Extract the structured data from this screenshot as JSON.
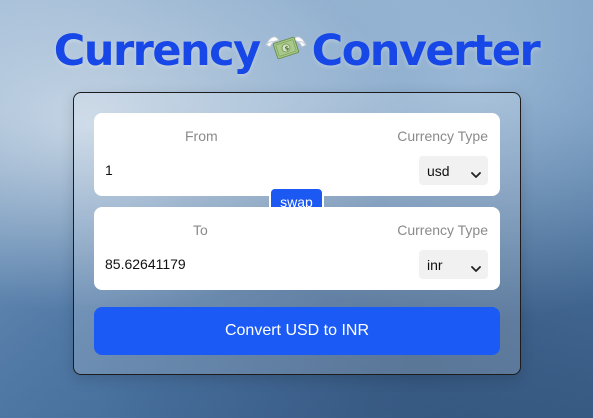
{
  "header": {
    "title_left": "Currency",
    "title_right": "Converter",
    "icon": "money-with-wings-icon"
  },
  "from": {
    "label": "From",
    "currency_label": "Currency Type",
    "amount": "1",
    "currency": "usd"
  },
  "swap": {
    "label": "swap"
  },
  "to": {
    "label": "To",
    "currency_label": "Currency Type",
    "amount": "85.62641179",
    "currency": "inr"
  },
  "convert": {
    "label": "Convert USD to INR"
  },
  "colors": {
    "title": "#1747e6",
    "accent": "#1c5af6"
  }
}
